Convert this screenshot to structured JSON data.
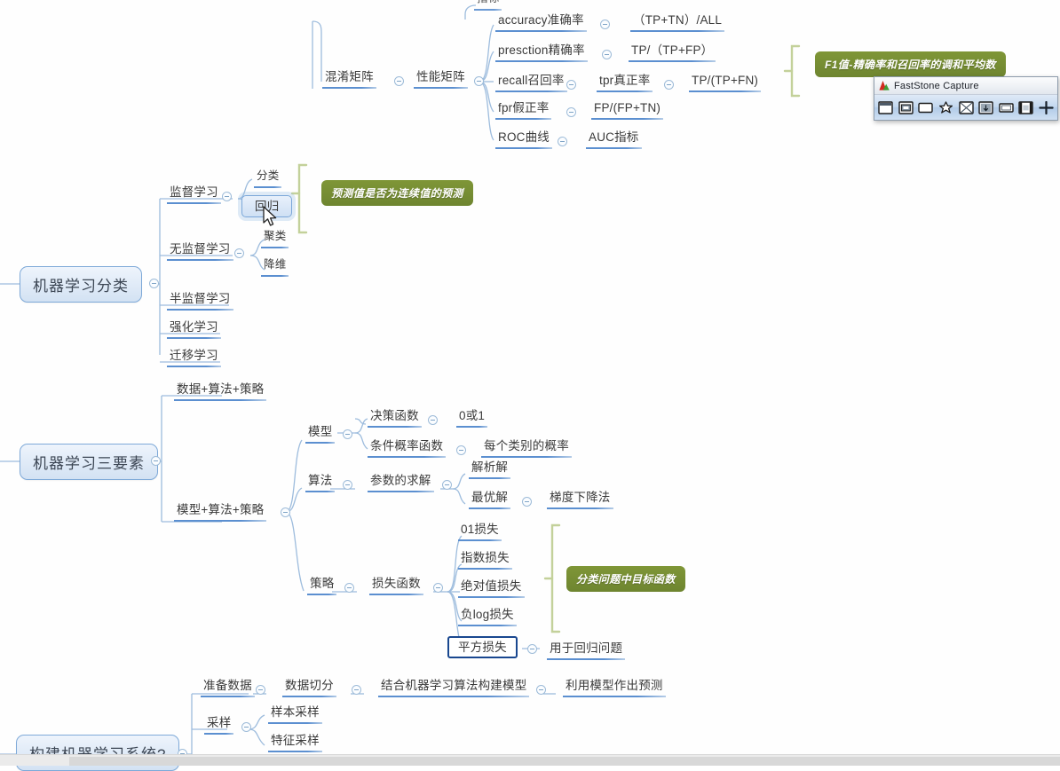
{
  "app": {
    "type": "mind-map-editor",
    "background": "#ffffff",
    "node_underline_color": "#5b8fd0",
    "root_fill": "#d3e2f3",
    "root_border": "#7ea9d8",
    "callout_color": "#6e8530",
    "selected_border": "#19478f"
  },
  "mindmap": {
    "clipped_top_node": "指标",
    "branch_metrics": {
      "root": "混淆矩阵",
      "level2": "性能矩阵",
      "items": [
        {
          "label": "accuracy准确率",
          "value": "（TP+TN）/ALL"
        },
        {
          "label": "presction精确率",
          "value": "TP/（TP+FP）"
        },
        {
          "label": "recall召回率",
          "mid": "tpr真正率",
          "value": "TP/(TP+FN)"
        },
        {
          "label": "fpr假正率",
          "value": "FP/(FP+TN)"
        },
        {
          "label": "ROC曲线",
          "value": "AUC指标"
        }
      ],
      "callout": "F1值-精确率和召回率的调和平均数"
    },
    "branch_classification": {
      "root": "机器学习分类",
      "children": [
        {
          "label": "监督学习",
          "children": [
            "分类",
            "回归"
          ]
        },
        {
          "label": "无监督学习",
          "children": [
            "聚类",
            "降维"
          ]
        },
        {
          "label": "半监督学习",
          "children": []
        },
        {
          "label": "强化学习",
          "children": []
        },
        {
          "label": "迁移学习",
          "children": []
        }
      ],
      "callout": "预测值是否为连续值的预测",
      "selected_child": "回归"
    },
    "branch_three_elements": {
      "root": "机器学习三要素",
      "children": [
        {
          "label": "数据+算法+策略"
        },
        {
          "label": "模型+算法+策略"
        }
      ],
      "model": {
        "label": "模型",
        "items": [
          {
            "label": "决策函数",
            "value": "0或1"
          },
          {
            "label": "条件概率函数",
            "value": "每个类别的概率"
          }
        ]
      },
      "algorithm": {
        "label": "算法",
        "sub": "参数的求解",
        "items": [
          {
            "label": "解析解",
            "value": ""
          },
          {
            "label": "最优解",
            "value": "梯度下降法"
          }
        ]
      },
      "strategy": {
        "label": "策略",
        "sub": "损失函数",
        "items": [
          {
            "label": "01损失",
            "value": ""
          },
          {
            "label": "指数损失",
            "value": ""
          },
          {
            "label": "绝对值损失",
            "value": ""
          },
          {
            "label": "负log损失",
            "value": ""
          },
          {
            "label": "平方损失",
            "value": "用于回归问题",
            "selected": true
          }
        ],
        "callout": "分类问题中目标函数"
      }
    },
    "branch_build_system": {
      "root": "构建机器学习系统?",
      "pipeline": [
        "准备数据",
        "数据切分",
        "结合机器学习算法构建模型",
        "利用模型作出预测"
      ],
      "sampling": {
        "label": "采样",
        "children": [
          "样本采样",
          "特征采样"
        ]
      }
    }
  },
  "faststone": {
    "title": "FastStone Capture",
    "logo_icon": "faststone-logo-icon",
    "toolbar": [
      {
        "name": "capture-active-window-icon",
        "tip": "Capture Active Window"
      },
      {
        "name": "capture-window-object-icon",
        "tip": "Capture Window/Object"
      },
      {
        "name": "capture-rectangular-region-icon",
        "tip": "Capture Rectangular Region"
      },
      {
        "name": "capture-freehand-region-icon",
        "tip": "Capture Freehand Region"
      },
      {
        "name": "capture-full-screen-icon",
        "tip": "Capture Full Screen"
      },
      {
        "name": "capture-scrolling-window-icon",
        "tip": "Capture Scrolling Window"
      },
      {
        "name": "capture-fixed-region-icon",
        "tip": "Capture Fixed Region"
      },
      {
        "name": "screen-recorder-icon",
        "tip": "Screen Recorder"
      },
      {
        "name": "settings-crosshair-icon",
        "tip": "Settings"
      }
    ]
  }
}
